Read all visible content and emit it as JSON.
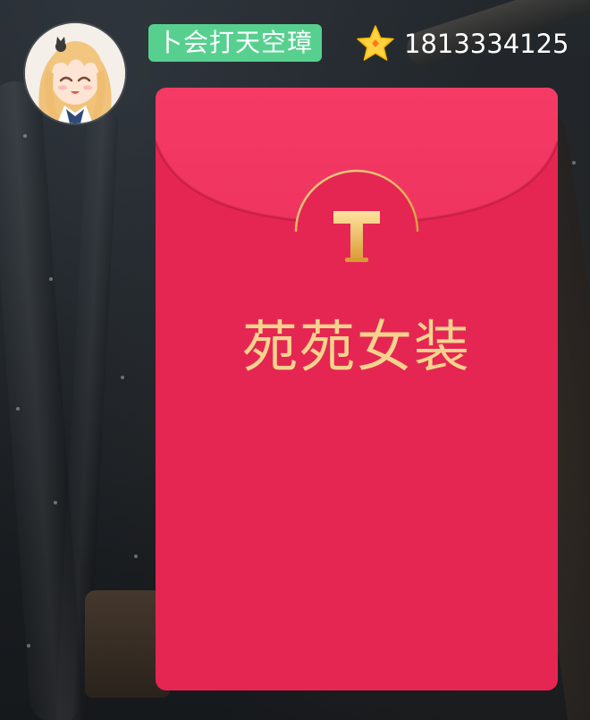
{
  "sender": {
    "name_badge": "卜会打天空璋",
    "user_id": "1813334125",
    "badge_color": "#57d08f"
  },
  "icons": {
    "avatar": "anime-avatar",
    "star": "star-icon",
    "seal": "t-logo-icon"
  },
  "packet": {
    "title": "苑苑女装",
    "seal_letter": "T",
    "color": "#e52652",
    "flap_color": "#f23762",
    "text_color": "#f6d38d"
  }
}
